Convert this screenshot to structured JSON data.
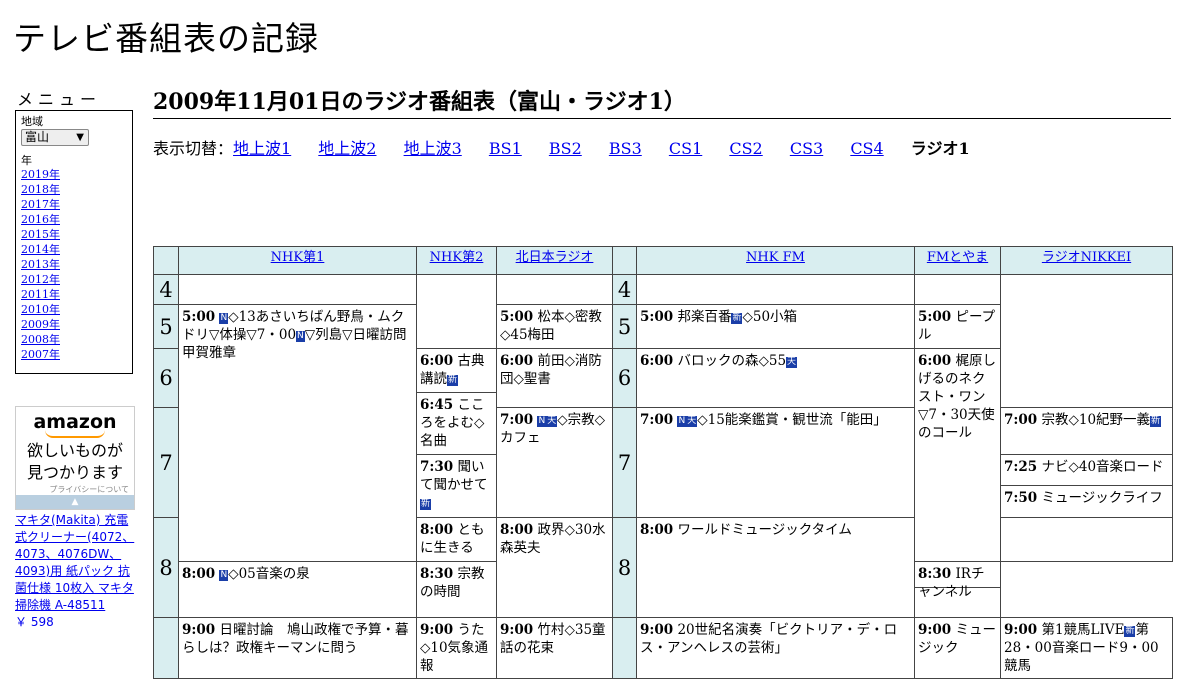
{
  "site": {
    "title": "テレビ番組表の記録"
  },
  "menu": {
    "heading": "メニュー",
    "region_label": "地域",
    "region_value": "富山",
    "year_label": "年",
    "years": [
      "2019年",
      "2018年",
      "2017年",
      "2016年",
      "2015年",
      "2014年",
      "2013年",
      "2012年",
      "2011年",
      "2010年",
      "2009年",
      "2008年",
      "2007年"
    ]
  },
  "ad": {
    "brand": "amazon",
    "tagline_1": "欲しいものが",
    "tagline_2": "見つかります",
    "privacy": "プライバシーについて",
    "product_text": "マキタ(Makita) 充電式クリーナー(4072、4073、4076DW、4093)用 紙パック 抗菌仕様 10枚入 マキタ 掃除機 A-48511",
    "price": "￥ 598"
  },
  "page": {
    "title": "2009年11月01日のラジオ番組表（富山・ラジオ1）"
  },
  "switcher": {
    "label": "表示切替：",
    "links": [
      "地上波1",
      "地上波2",
      "地上波3",
      "BS1",
      "BS2",
      "BS3",
      "CS1",
      "CS2",
      "CS3",
      "CS4"
    ],
    "current": "ラジオ1"
  },
  "icons": {
    "news": "N",
    "new": "新",
    "stereo": "天"
  },
  "grid": {
    "channels": [
      "NHK第1",
      "NHK第2",
      "北日本ラジオ",
      "NHK FM",
      "FMとやま",
      "ラジオNIKKEI"
    ],
    "hours": [
      "4",
      "5",
      "6",
      "7",
      "8"
    ],
    "programs": {
      "nhk1_500_time": "5:00",
      "nhk1_500_text_a": "◇13あさいちばん野鳥・ムクドリ▽体操▽7・00",
      "nhk1_500_text_b": "▽列島▽日曜訪問　甲賀雅章",
      "nhk1_800_time": "8:00",
      "nhk1_800_text": "◇05音楽の泉",
      "nhk1_900_time": "9:00",
      "nhk1_900_text": "日曜討論　鳩山政権で予算・暮らしは？政権キーマンに問う",
      "nhk2_600_time": "6:00",
      "nhk2_600_text": "古典講読",
      "nhk2_645_time": "6:45",
      "nhk2_645_text": "こころをよむ◇名曲",
      "nhk2_730_time": "7:30",
      "nhk2_730_text": "聞いて聞かせて",
      "nhk2_800_time": "8:00",
      "nhk2_800_text": "ともに生きる",
      "nhk2_830_time": "8:30",
      "nhk2_830_text": "宗教の時間",
      "nhk2_900_time": "9:00",
      "nhk2_900_text": "うた◇10気象通報",
      "knb_500_time": "5:00",
      "knb_500_text": "松本◇密教◇45梅田",
      "knb_600_time": "6:00",
      "knb_600_text": "前田◇消防団◇聖書",
      "knb_700_time": "7:00",
      "knb_700_text": "◇宗教◇カフェ",
      "knb_800_time": "8:00",
      "knb_800_text": "政界◇30水森英夫",
      "knb_900_time": "9:00",
      "knb_900_text": "竹村◇35童話の花束",
      "fm_500_time": "5:00",
      "fm_500_text_a": "邦楽百番",
      "fm_500_text_b": "◇50小箱",
      "fm_600_time": "6:00",
      "fm_600_text": "バロックの森◇55",
      "fm_700_time": "7:00",
      "fm_700_text": "◇15能楽鑑賞・観世流「能田」",
      "fm_800_time": "8:00",
      "fm_800_text": "ワールドミュージックタイム",
      "fm_900_time": "9:00",
      "fm_900_text": "20世紀名演奏「ビクトリア・デ・ロス・アンヘレスの芸術」",
      "fmt_500_time": "5:00",
      "fmt_500_text": "ピープル",
      "fmt_600_time": "6:00",
      "fmt_600_text": "梶原しげるのネクスト・ワン▽7・30天使のコール",
      "fmt_900_time": "9:00",
      "fmt_900_text": "ミュージック",
      "nik_700_time": "7:00",
      "nik_700_text": "宗教◇10紀野一義",
      "nik_725_time": "7:25",
      "nik_725_text": "ナビ◇40音楽ロード",
      "nik_750_time": "7:50",
      "nik_750_text": "ミュージックライフ",
      "nik_830_time": "8:30",
      "nik_830_text": "IRチャンネル",
      "nik_900_time": "9:00",
      "nik_900_text_a": "第1競馬LIVE",
      "nik_900_text_b": "第28・00音楽ロード9・00競馬"
    }
  }
}
